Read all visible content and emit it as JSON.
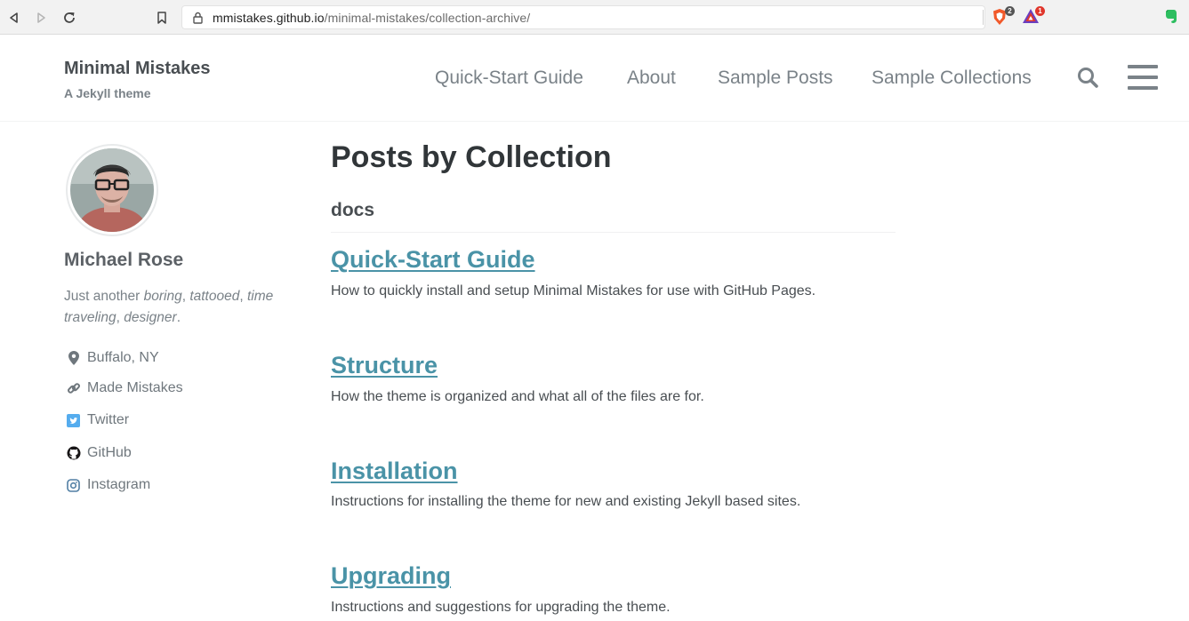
{
  "browser": {
    "url_host": "mmistakes.github.io",
    "url_path": "/minimal-mistakes/collection-archive/",
    "extensions": [
      {
        "name": "brave-shields-icon",
        "badge": "2",
        "badge_color": "#555555"
      },
      {
        "name": "brave-rewards-icon",
        "badge": "1",
        "badge_color": "#e0362b"
      },
      {
        "name": "evernote-icon",
        "badge": null
      }
    ]
  },
  "site": {
    "title": "Minimal Mistakes",
    "subtitle": "A Jekyll theme",
    "nav": [
      {
        "label": "Quick-Start Guide"
      },
      {
        "label": "About"
      },
      {
        "label": "Sample Posts"
      },
      {
        "label": "Sample Collections"
      }
    ]
  },
  "author": {
    "name": "Michael Rose",
    "bio_parts": [
      "Just another ",
      "boring",
      ", ",
      "tattooed",
      ", ",
      "time traveling",
      ", ",
      "designer",
      "."
    ],
    "links": [
      {
        "label": "Buffalo, NY",
        "icon": "map-marker-icon"
      },
      {
        "label": "Made Mistakes",
        "icon": "link-icon"
      },
      {
        "label": "Twitter",
        "icon": "twitter-icon"
      },
      {
        "label": "GitHub",
        "icon": "github-icon"
      },
      {
        "label": "Instagram",
        "icon": "instagram-icon"
      }
    ]
  },
  "main": {
    "page_title": "Posts by Collection",
    "collection": "docs",
    "posts": [
      {
        "title": "Quick-Start Guide",
        "excerpt": "How to quickly install and setup Minimal Mistakes for use with GitHub Pages."
      },
      {
        "title": "Structure",
        "excerpt": "How the theme is organized and what all of the files are for."
      },
      {
        "title": "Installation",
        "excerpt": "Instructions for installing the theme for new and existing Jekyll based sites."
      },
      {
        "title": "Upgrading",
        "excerpt": "Instructions and suggestions for upgrading the theme."
      }
    ]
  },
  "colors": {
    "link": "#4a93a7",
    "text": "#494e52",
    "muted": "#7a8288"
  }
}
